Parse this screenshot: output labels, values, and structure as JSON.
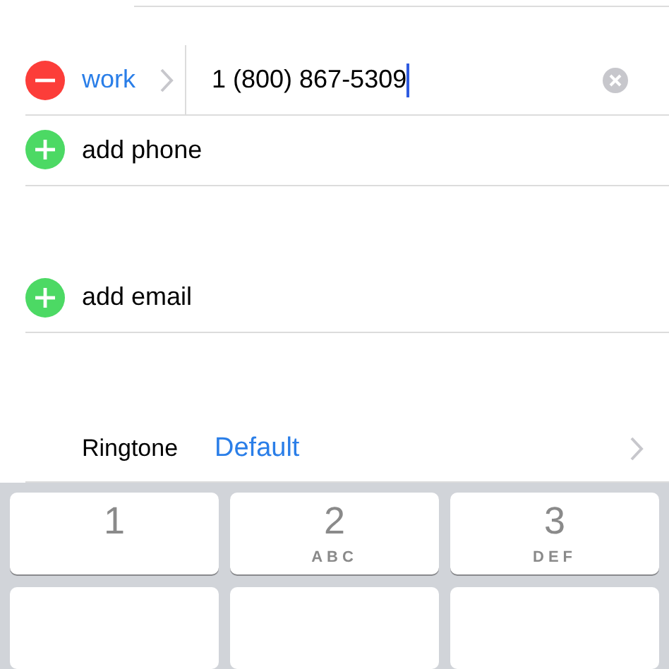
{
  "phone": {
    "label": "work",
    "value": "1 (800) 867-5309"
  },
  "add_phone": {
    "label": "add phone"
  },
  "add_email": {
    "label": "add email"
  },
  "ringtone": {
    "label": "Ringtone",
    "value": "Default"
  },
  "keypad": [
    {
      "digit": "1"
    },
    {
      "digit": "2",
      "letters": "ABC"
    },
    {
      "digit": "3",
      "letters": "DEF"
    }
  ]
}
